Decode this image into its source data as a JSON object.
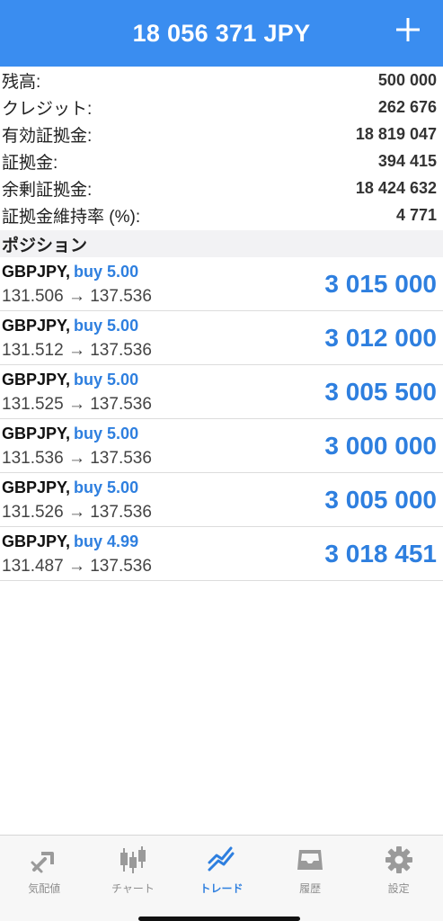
{
  "header": {
    "title": "18 056 371 JPY",
    "add_icon": "plus-icon"
  },
  "summary": [
    {
      "label": "残高:",
      "value": "500 000"
    },
    {
      "label": "クレジット:",
      "value": "262 676"
    },
    {
      "label": "有効証拠金:",
      "value": "18 819 047"
    },
    {
      "label": "証拠金:",
      "value": "394 415"
    },
    {
      "label": "余剰証拠金:",
      "value": "18 424 632"
    },
    {
      "label": "証拠金維持率 (%):",
      "value": "4 771"
    }
  ],
  "section_title": "ポジション",
  "positions": [
    {
      "symbol": "GBPJPY,",
      "side": "buy 5.00",
      "prices": "131.506 → 137.536",
      "profit": "3 015 000"
    },
    {
      "symbol": "GBPJPY,",
      "side": "buy 5.00",
      "prices": "131.512 → 137.536",
      "profit": "3 012 000"
    },
    {
      "symbol": "GBPJPY,",
      "side": "buy 5.00",
      "prices": "131.525 → 137.536",
      "profit": "3 005 500"
    },
    {
      "symbol": "GBPJPY,",
      "side": "buy 5.00",
      "prices": "131.536 → 137.536",
      "profit": "3 000 000"
    },
    {
      "symbol": "GBPJPY,",
      "side": "buy 5.00",
      "prices": "131.526 → 137.536",
      "profit": "3 005 000"
    },
    {
      "symbol": "GBPJPY,",
      "side": "buy 4.99",
      "prices": "131.487 → 137.536",
      "profit": "3 018 451"
    }
  ],
  "tabs": [
    {
      "label": "気配値",
      "icon": "quotes-icon",
      "active": false
    },
    {
      "label": "チャート",
      "icon": "candlestick-chart-icon",
      "active": false
    },
    {
      "label": "トレード",
      "icon": "trade-icon",
      "active": true
    },
    {
      "label": "履歴",
      "icon": "history-inbox-icon",
      "active": false
    },
    {
      "label": "設定",
      "icon": "gear-icon",
      "active": false
    }
  ],
  "colors": {
    "header": "#3a8df0",
    "accent": "#2e7fdf",
    "inactive": "#8e8e8e"
  }
}
